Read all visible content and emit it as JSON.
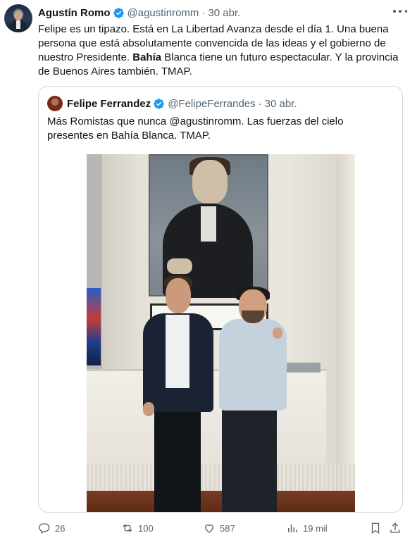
{
  "tweet": {
    "author_name": "Agustín Romo",
    "author_handle": "@agustinromm",
    "separator": "·",
    "date": "30 abr.",
    "text_part1": "Felipe es un tipazo. Está en La Libertad Avanza desde el día 1. Una buena persona que está absolutamente convencida de las ideas y el gobierno de nuestro Presidente. ",
    "text_bold": "Bahía",
    "text_part2": " Blanca tiene un futuro espectacular. Y la provincia de Buenos Aires también. TMAP."
  },
  "quote": {
    "author_name": "Felipe Ferrandez",
    "author_handle": "@FelipeFerrandes",
    "separator": "·",
    "date": "30 abr.",
    "text": "Más Romistas que nunca @agustinromm. Las fuerzas del cielo presentes en Bahía Blanca. TMAP."
  },
  "actions": {
    "replies": "26",
    "reposts": "100",
    "likes": "587",
    "views": "19 mil"
  },
  "colors": {
    "verified": "#1d9bf0",
    "muted": "#536471",
    "text": "#0f1419",
    "border": "#cfd9de"
  }
}
